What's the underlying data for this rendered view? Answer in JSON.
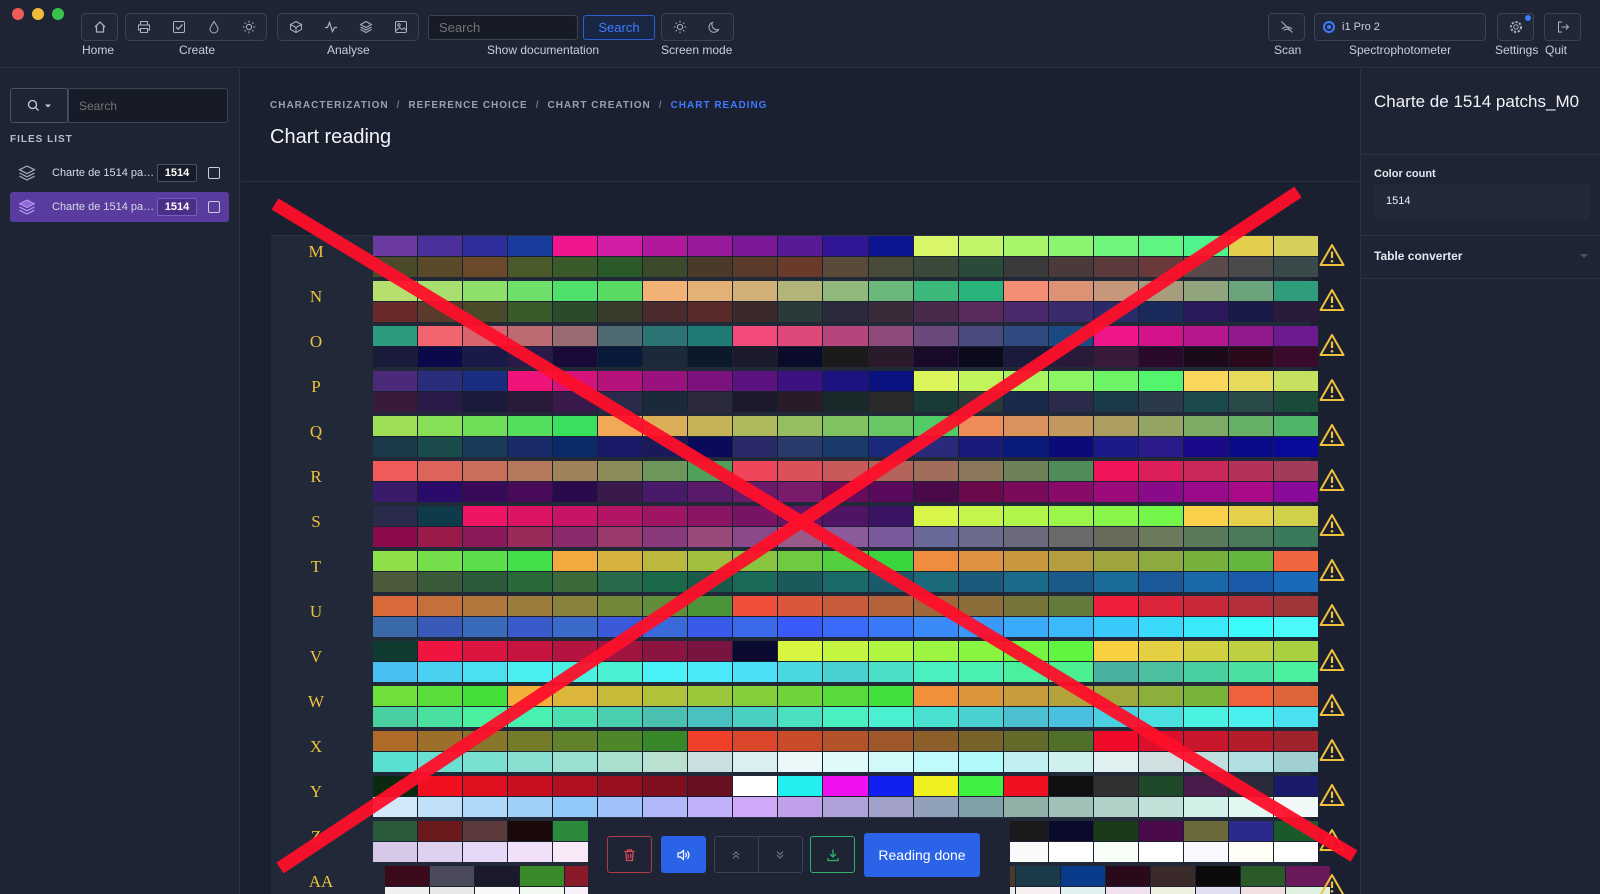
{
  "toolbar": {
    "home_label": "Home",
    "create_label": "Create",
    "analyse_label": "Analyse",
    "search_placeholder": "Search",
    "search_button": "Search",
    "show_documentation_label": "Show documentation",
    "screen_mode_label": "Screen mode",
    "scan_label": "Scan",
    "spectrophotometer_value": "i1 Pro 2",
    "spectrophotometer_label": "Spectrophotometer",
    "settings_label": "Settings",
    "quit_label": "Quit"
  },
  "sidebar": {
    "search_placeholder": "Search",
    "files_title": "FILES LIST",
    "files": [
      {
        "name": "Charte de 1514 patchs_M0",
        "count": "1514",
        "active": false
      },
      {
        "name": "Charte de 1514 patchs_M0",
        "count": "1514",
        "active": true
      }
    ]
  },
  "breadcrumb": {
    "items": [
      "CHARACTERIZATION",
      "REFERENCE CHOICE",
      "CHART CREATION",
      "CHART READING"
    ],
    "separator": "/"
  },
  "main": {
    "title": "Chart reading",
    "row_labels": [
      "M",
      "N",
      "O",
      "P",
      "Q",
      "R",
      "S",
      "T",
      "U",
      "V",
      "W",
      "X",
      "Y",
      "Z",
      "AA"
    ]
  },
  "bottom_bar": {
    "reading_done": "Reading done"
  },
  "right_panel": {
    "title": "Charte de 1514 patchs_M0",
    "color_count_label": "Color count",
    "color_count_value": "1514",
    "table_converter_label": "Table converter"
  },
  "colors": {
    "accent": "#3e7bff",
    "active_file": "#5a3b9e",
    "warning": "#f0c23b",
    "overlay_cross": "#ff0f2a",
    "delete": "#e24b55",
    "download": "#2fb36a"
  }
}
